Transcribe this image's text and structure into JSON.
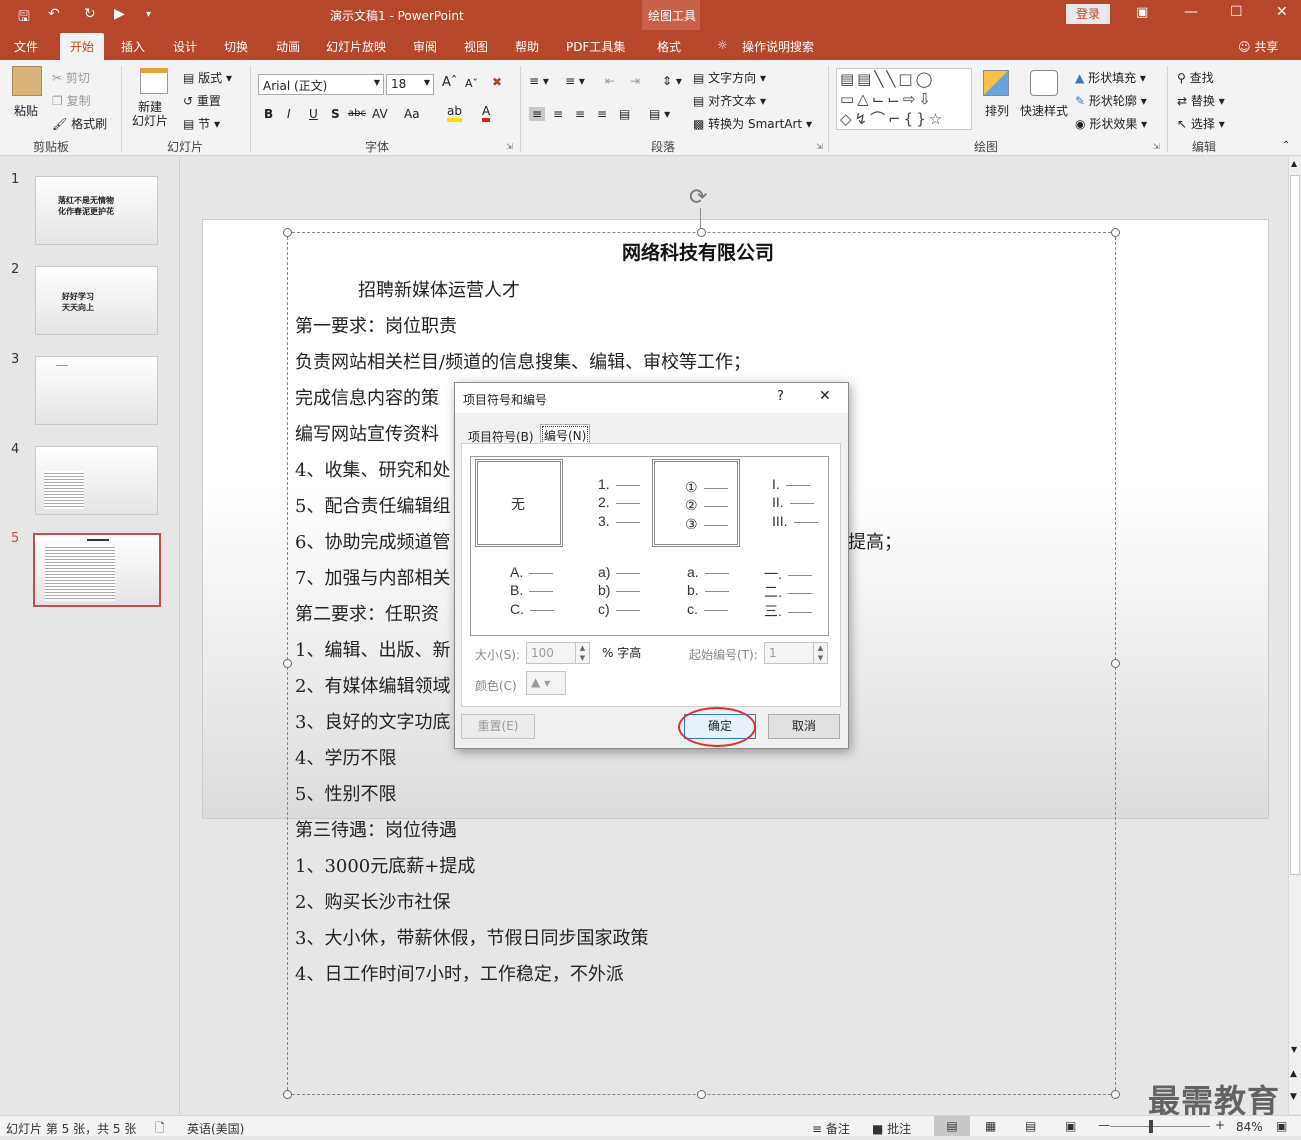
{
  "window": {
    "title": "演示文稿1 - PowerPoint",
    "context_tab_group": "绘图工具",
    "login": "登录",
    "controls": [
      "ribbon-display",
      "minimize",
      "maximize",
      "close"
    ]
  },
  "tabs": [
    "文件",
    "开始",
    "插入",
    "设计",
    "切换",
    "动画",
    "幻灯片放映",
    "审阅",
    "视图",
    "帮助",
    "PDF工具集",
    "格式"
  ],
  "active_tab": "开始",
  "tell_me": "操作说明搜索",
  "share": "共享",
  "ribbon": {
    "clipboard": {
      "paste": "粘贴",
      "cut": "剪切",
      "copy": "复制",
      "format_painter": "格式刷",
      "label": "剪贴板"
    },
    "slides": {
      "new_slide": "新建\n幻灯片",
      "layout": "版式",
      "reset": "重置",
      "section": "节",
      "label": "幻灯片"
    },
    "font": {
      "name": "Arial (正文)",
      "size": "18",
      "label": "字体",
      "buttons": [
        "B",
        "I",
        "U",
        "S",
        "abc",
        "AV",
        "Aa",
        "A"
      ]
    },
    "paragraph": {
      "text_direction": "文字方向",
      "align_text": "对齐文本",
      "smartart": "转换为 SmartArt",
      "label": "段落"
    },
    "drawing": {
      "arrange": "排列",
      "quick_styles": "快速样式",
      "shape_fill": "形状填充",
      "shape_outline": "形状轮廓",
      "shape_effects": "形状效果",
      "label": "绘图"
    },
    "editing": {
      "find": "查找",
      "replace": "替换",
      "select": "选择",
      "label": "编辑"
    }
  },
  "thumbnails": [
    {
      "num": "1",
      "text": "落红不是无情物\n化作春泥更护花"
    },
    {
      "num": "2",
      "text": "好好学习\n天天向上"
    },
    {
      "num": "3",
      "text": ""
    },
    {
      "num": "4",
      "text": ""
    },
    {
      "num": "5",
      "text": ""
    }
  ],
  "selected_slide": 5,
  "slide": {
    "title": "网络科技有限公司",
    "lines": [
      "招聘新媒体运营人才",
      "第一要求：岗位职责",
      "负责网站相关栏目/频道的信息搜集、编辑、审校等工作；",
      "完成信息内容的策",
      "编写网站宣传资料",
      "4、收集、研究和处",
      "5、配合责任编辑组",
      "6、协助完成频道管",
      "7、加强与内部相关",
      "第二要求：任职资",
      "1、编辑、出版、新",
      "2、有媒体编辑领域",
      "3、良好的文字功底",
      "4、学历不限",
      "5、性别不限",
      "第三待遇：岗位待遇",
      "1、3000元底薪+提成",
      "2、购买长沙市社保",
      "3、大小休，带薪休假，节假日同步国家政策",
      "4、日工作时间7小时，工作稳定，不外派"
    ],
    "overflow_tail": "提高；"
  },
  "dialog": {
    "title": "项目符号和编号",
    "help": "?",
    "close": "✕",
    "tabs": [
      "项目符号(B)",
      "编号(N)"
    ],
    "active_tab": "编号(N)",
    "none_label": "无",
    "styles": [
      [
        "1.",
        "2.",
        "3."
      ],
      [
        "①",
        "②",
        "③"
      ],
      [
        "I.",
        "II.",
        "III."
      ],
      [
        "A.",
        "B.",
        "C."
      ],
      [
        "a)",
        "b)",
        "c)"
      ],
      [
        "a.",
        "b.",
        "c."
      ],
      [
        "一.",
        "二.",
        "三."
      ]
    ],
    "selected_style": "①",
    "size_label": "大小(S):",
    "size_value": "100",
    "size_unit": "% 字高",
    "start_label": "起始编号(T):",
    "start_value": "1",
    "color_label": "颜色(C)",
    "reset": "重置(E)",
    "ok": "确定",
    "cancel": "取消"
  },
  "status": {
    "slide_info": "幻灯片 第 5 张，共 5 张",
    "language": "英语(美国)",
    "notes": "备注",
    "comments": "批注",
    "zoom": "84%",
    "zoom_level": 0.84
  },
  "watermark": "最需教育",
  "colors": {
    "accent": "#b7472a",
    "highlight_circle": "#e03030"
  }
}
